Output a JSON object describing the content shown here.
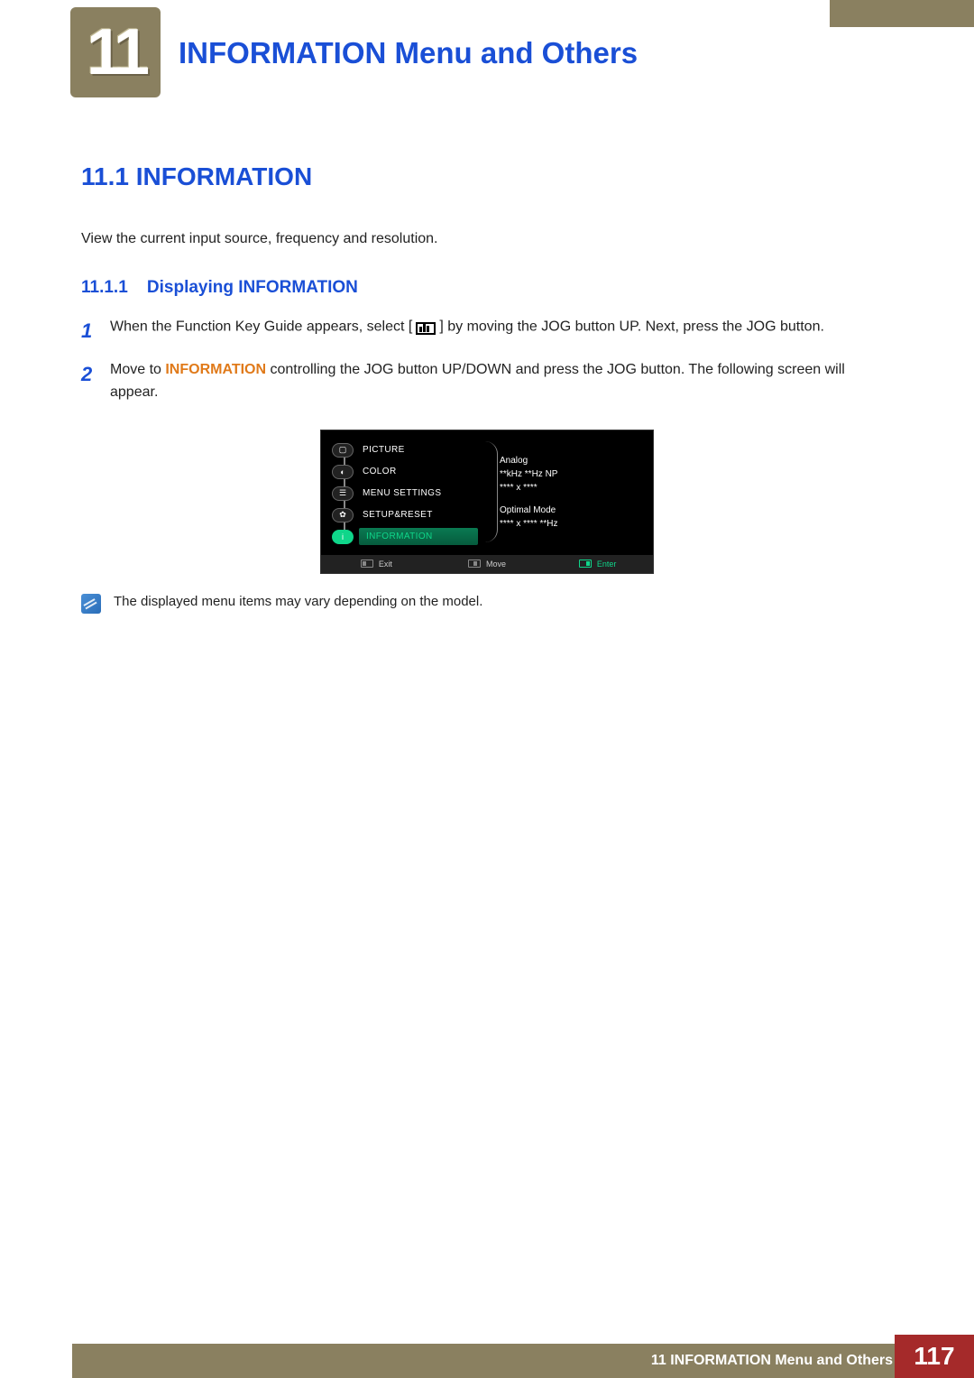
{
  "header": {
    "chapter_number": "11",
    "chapter_title": "INFORMATION Menu and Others"
  },
  "section": {
    "number_and_title": "11.1  INFORMATION",
    "intro": "View the current input source, frequency and resolution."
  },
  "subsection": {
    "number": "11.1.1",
    "title": "Displaying INFORMATION"
  },
  "steps": {
    "s1": {
      "num": "1",
      "before_icon": "When the Function Key Guide appears, select ",
      "after_icon": " by moving the JOG button UP. Next, press the JOG button."
    },
    "s2": {
      "num": "2",
      "before_kw": "Move to  ",
      "keyword": "INFORMATION",
      "after_kw": " controlling the JOG button UP/DOWN and press the JOG button. The following screen will appear."
    }
  },
  "osd": {
    "items": {
      "picture": "PICTURE",
      "color": "COLOR",
      "menu_settings": "MENU SETTINGS",
      "setup_reset": "SETUP&RESET",
      "information": "INFORMATION"
    },
    "info": {
      "line1": "Analog",
      "line2": "**kHz  **Hz  NP",
      "line3": "****  x  ****",
      "line4": "Optimal Mode",
      "line5": "****  x  ****  **Hz"
    },
    "bottom": {
      "exit": "Exit",
      "move": "Move",
      "enter": "Enter"
    }
  },
  "note": {
    "text": "The displayed menu items may vary depending on the model."
  },
  "footer": {
    "chapter_ref": "11 INFORMATION Menu and Others",
    "page": "117"
  }
}
